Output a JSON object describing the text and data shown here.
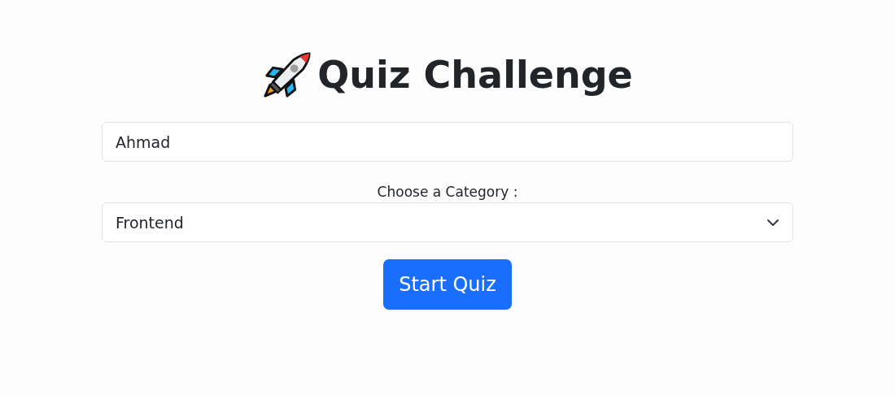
{
  "title": "Quiz Challenge",
  "name_field": {
    "value": "Ahmad"
  },
  "category": {
    "label": "Choose a Category :",
    "value": "Frontend"
  },
  "start_button": {
    "label": "Start Quiz"
  }
}
